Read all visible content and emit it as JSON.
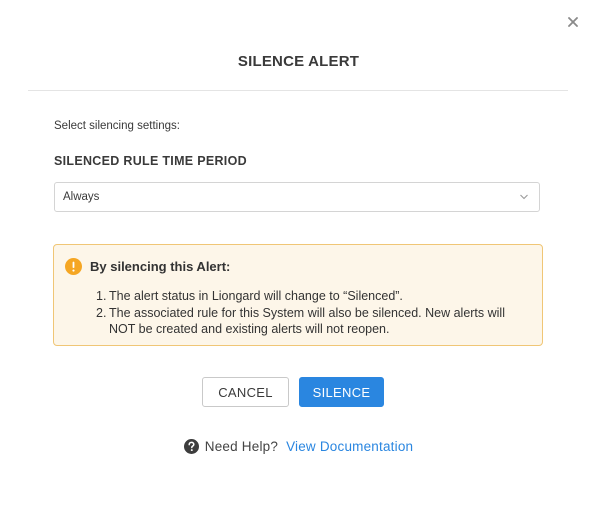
{
  "dialog": {
    "title": "SILENCE ALERT",
    "close_icon": "close-icon",
    "intro": "Select silencing settings:",
    "time_period": {
      "label": "SILENCED RULE TIME PERIOD",
      "selected": "Always",
      "chevron_icon": "chevron-down-icon"
    },
    "notice": {
      "icon": "exclamation-circle-icon",
      "heading": "By silencing this Alert:",
      "items": [
        {
          "number": "1.",
          "text": "The alert status in Liongard will change to “Silenced”."
        },
        {
          "number": "2.",
          "text": "The associated rule for this System will also be silenced. New alerts will NOT be created and existing alerts will not reopen."
        }
      ]
    },
    "buttons": {
      "cancel": "CANCEL",
      "silence": "SILENCE"
    },
    "help": {
      "icon": "question-circle-icon",
      "text": "Need Help?",
      "link": "View Documentation"
    }
  },
  "colors": {
    "primary": "#2a86e0",
    "notice_background": "#fdf6e9",
    "notice_border": "#f0c676",
    "warning_icon": "#f5a623"
  }
}
